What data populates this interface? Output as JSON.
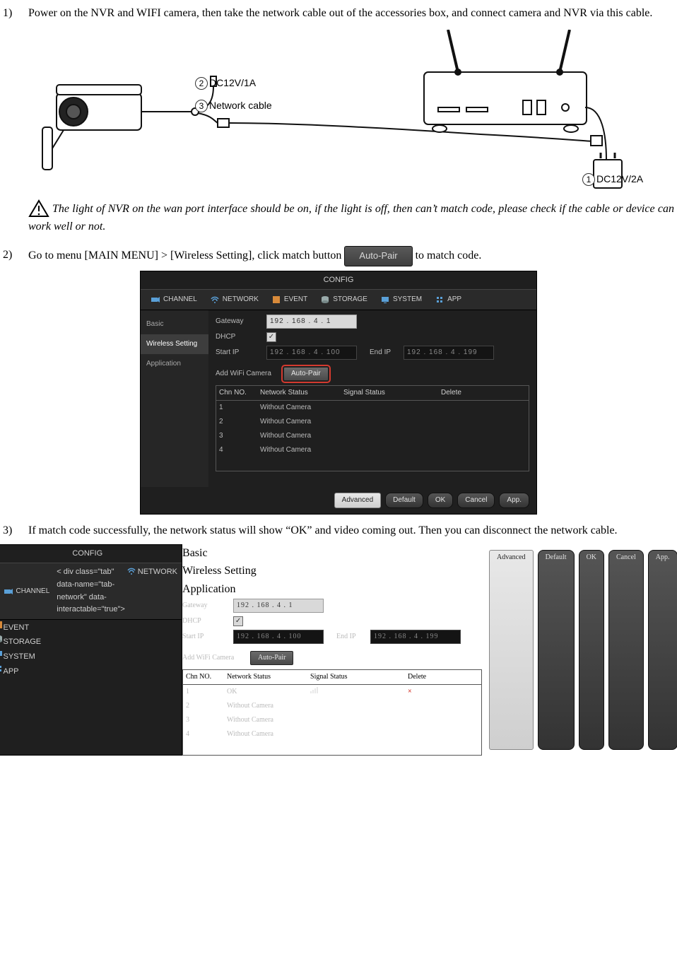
{
  "steps": {
    "s1": {
      "num": "1)",
      "text": "Power on the NVR and WIFI camera, then take the network cable out of the accessories box, and connect camera and NVR via this cable."
    },
    "s2": {
      "num": "2)",
      "text_a": "Go to menu [MAIN MENU] > [Wireless Setting], click match button ",
      "btn": "Auto-Pair",
      "text_b": "to match code."
    },
    "s3": {
      "num": "3)",
      "text": "If match code successfully, the network status will show “OK” and video coming out. Then you can disconnect the network cable."
    }
  },
  "warning": "The light of NVR on the wan port interface should be on, if the light is off, then can’t match code, please check if the cable or device can work well or not.",
  "diagram": {
    "label1": "DC12V/2A",
    "label2": "DC12V/1A",
    "label3": "Network cable",
    "n1": "1",
    "n2": "2",
    "n3": "3"
  },
  "config": {
    "title": "CONFIG",
    "tabs": [
      "CHANNEL",
      "NETWORK",
      "EVENT",
      "STORAGE",
      "SYSTEM",
      "APP"
    ],
    "side": [
      "Basic",
      "Wireless Setting",
      "Application"
    ],
    "labels": {
      "gateway": "Gateway",
      "dhcp": "DHCP",
      "startip": "Start IP",
      "endip": "End IP",
      "addcam": "Add WiFi Camera",
      "autopair": "Auto-Pair"
    },
    "ips": {
      "gateway": "192 . 168 .  4 .  1",
      "start": "192 . 168 .  4 . 100",
      "end": "192 . 168 .  4 . 199"
    },
    "table": {
      "hdr": [
        "Chn NO.",
        "Network Status",
        "Signal Status",
        "Delete"
      ],
      "rows1": [
        {
          "n": "1",
          "s": "Without Camera"
        },
        {
          "n": "2",
          "s": "Without Camera"
        },
        {
          "n": "3",
          "s": "Without Camera"
        },
        {
          "n": "4",
          "s": "Without Camera"
        }
      ],
      "rows2": [
        {
          "n": "1",
          "s": "OK",
          "sig": true,
          "del": true
        },
        {
          "n": "2",
          "s": "Without Camera"
        },
        {
          "n": "3",
          "s": "Without Camera"
        },
        {
          "n": "4",
          "s": "Without Camera"
        }
      ]
    },
    "buttons": {
      "adv": "Advanced",
      "def": "Default",
      "ok": "OK",
      "cancel": "Cancel",
      "app": "App."
    }
  }
}
